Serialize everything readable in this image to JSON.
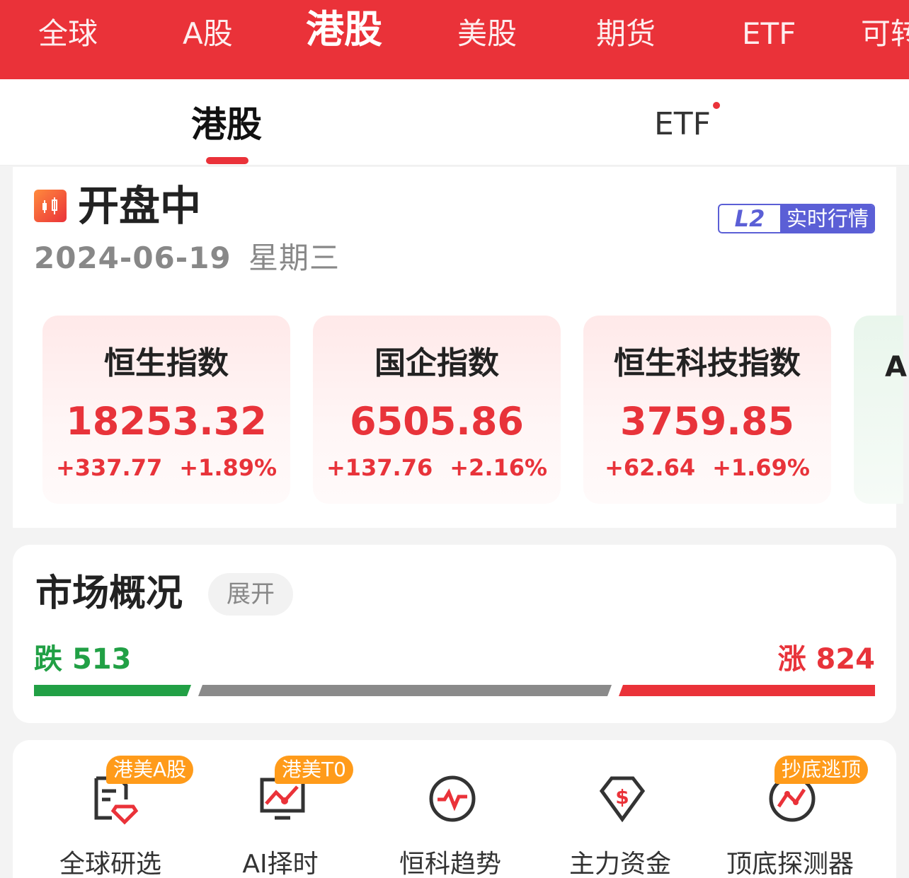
{
  "top_nav": {
    "tabs": [
      {
        "label": "全球",
        "active": false
      },
      {
        "label": "A股",
        "active": false
      },
      {
        "label": "港股",
        "active": true
      },
      {
        "label": "美股",
        "active": false
      },
      {
        "label": "期货",
        "active": false
      },
      {
        "label": "ETF",
        "active": false
      },
      {
        "label": "可转",
        "active": false
      }
    ]
  },
  "sub_nav": {
    "tabs": [
      {
        "label": "港股",
        "active": true
      },
      {
        "label": "ETF",
        "active": false,
        "has_dot": true
      }
    ]
  },
  "market_status": {
    "status": "开盘中",
    "date": "2024-06-19",
    "weekday": "星期三",
    "badge_logo": "L2",
    "badge_label": "实时行情"
  },
  "indices": [
    {
      "name": "恒生指数",
      "value": "18253.32",
      "change": "+337.77",
      "change_pct": "+1.89%"
    },
    {
      "name": "国企指数",
      "value": "6505.86",
      "change": "+137.76",
      "change_pct": "+2.16%"
    },
    {
      "name": "恒生科技指数",
      "value": "3759.85",
      "change": "+62.64",
      "change_pct": "+1.69%"
    },
    {
      "name": "A",
      "value": "",
      "change": "",
      "change_pct": ""
    }
  ],
  "market_overview": {
    "title": "市场概况",
    "expand_label": "展开",
    "down_label": "跌",
    "down_count": "513",
    "up_label": "涨",
    "up_count": "824"
  },
  "tools": [
    {
      "label": "全球研选",
      "badge": "港美A股",
      "icon": "document-diamond-icon"
    },
    {
      "label": "AI择时",
      "badge": "港美T0",
      "icon": "monitor-chart-icon"
    },
    {
      "label": "恒科趋势",
      "badge": "",
      "icon": "pulse-icon"
    },
    {
      "label": "主力资金",
      "badge": "",
      "icon": "dollar-diamond-icon"
    },
    {
      "label": "顶底探测器",
      "badge": "抄底逃顶",
      "icon": "trend-circle-icon"
    }
  ],
  "colors": {
    "brand_red": "#ea3239",
    "up_red": "#e8333a",
    "down_green": "#21a045",
    "badge_orange": "#ff9b1a",
    "l2_purple": "#5b5fd6"
  }
}
